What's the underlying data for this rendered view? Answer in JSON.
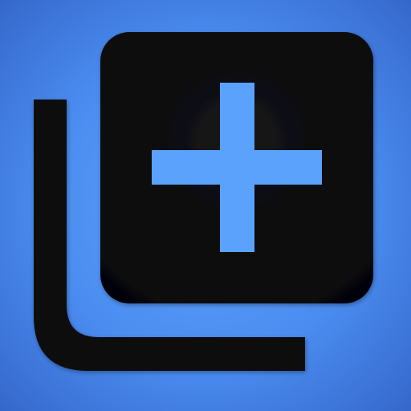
{
  "icon": {
    "name": "add-to-collection-icon",
    "colors": {
      "background_center": "#5ea4ff",
      "background_mid": "#4a8bef",
      "background_edge": "#3566c9",
      "glyph_dark": "#0b0b0d",
      "glyph_dark_edge": "#050506",
      "plus_accent": "#5aa2fb"
    }
  }
}
